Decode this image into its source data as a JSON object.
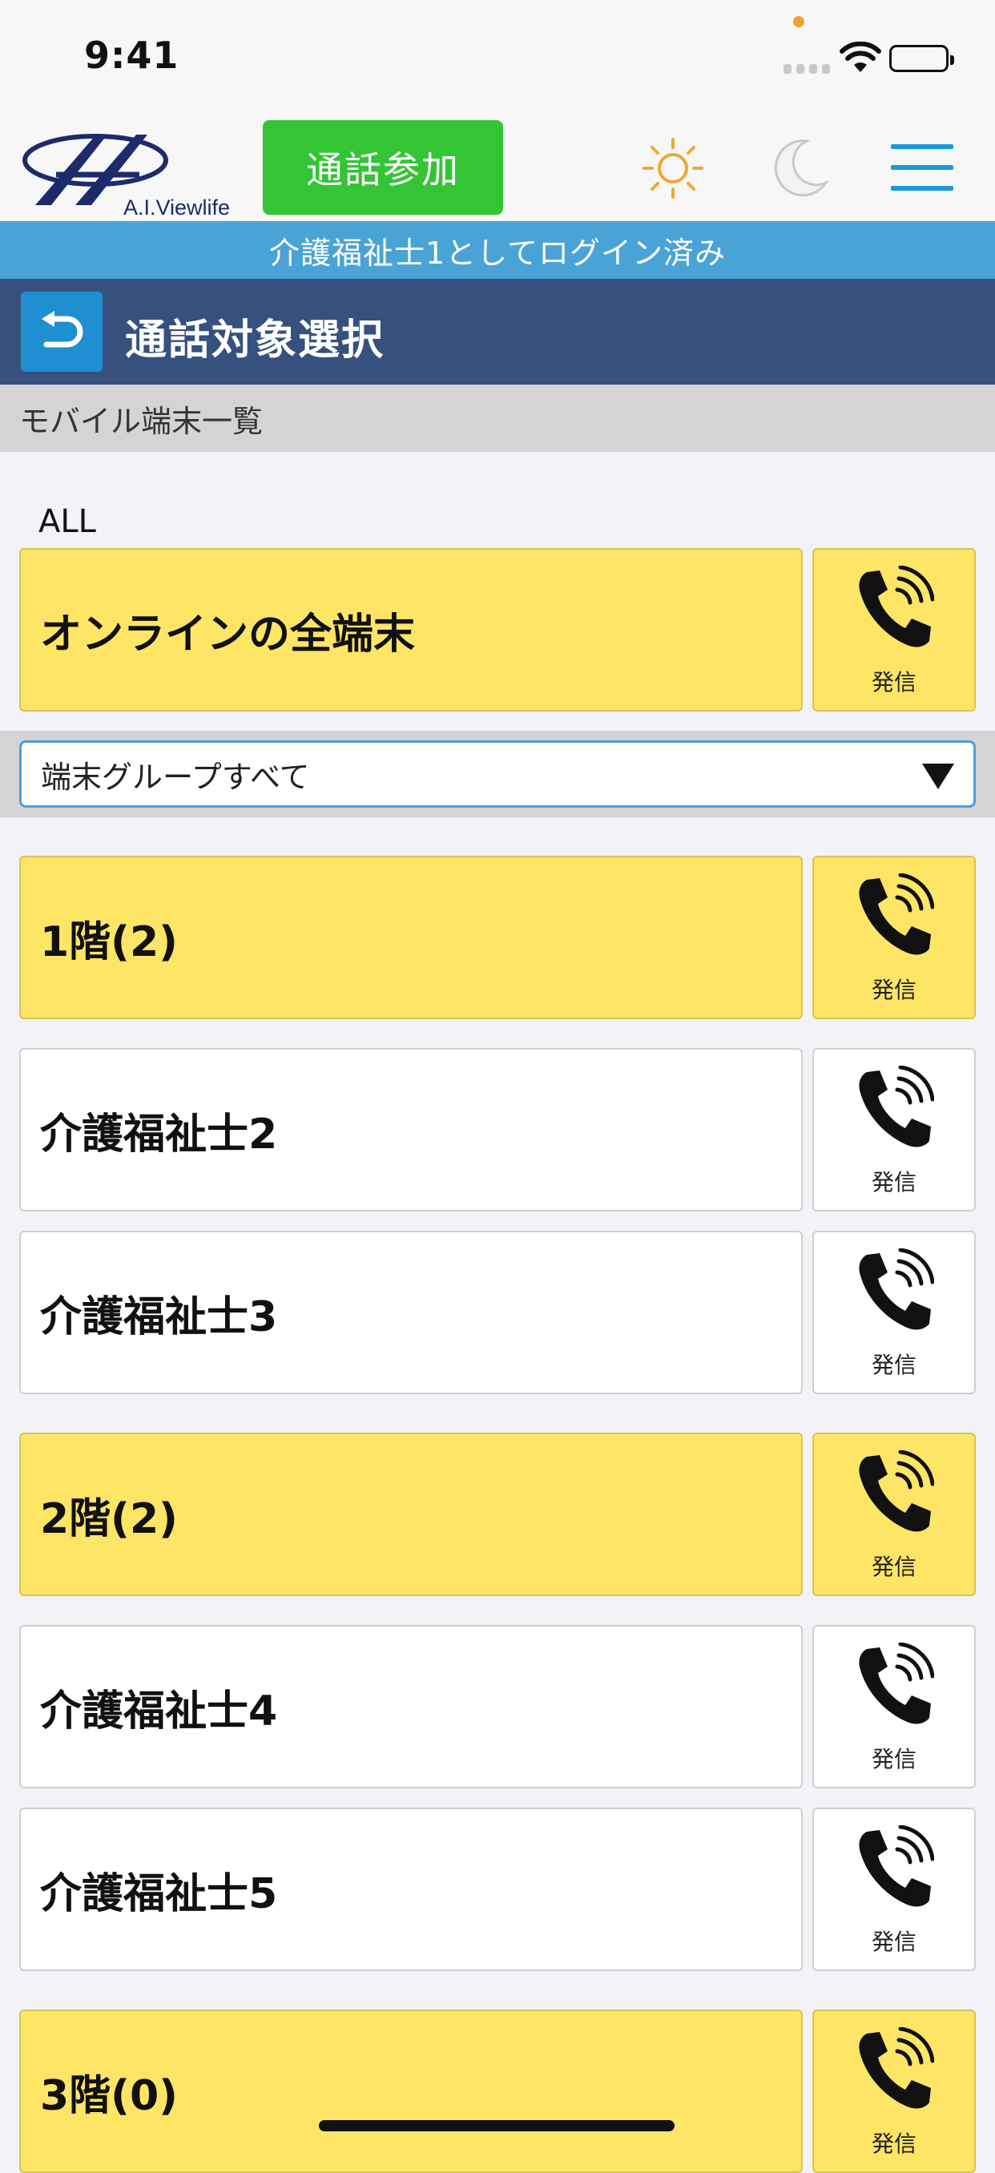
{
  "status_bar": {
    "time": "9:41"
  },
  "header": {
    "logo_text": "A.I.Viewlife",
    "join_call_label": "通話参加"
  },
  "login_banner": "介護福祉士1としてログイン済み",
  "title_bar": {
    "title": "通話対象選択"
  },
  "section": {
    "title": "モバイル端末一覧",
    "all_label": "ALL"
  },
  "all_row": {
    "name": "オンラインの全端末",
    "call_label": "発信"
  },
  "group_filter": {
    "selected": "端末グループすべて"
  },
  "rows": [
    {
      "name": "1階(2)",
      "call_label": "発信"
    },
    {
      "name": "介護福祉士2",
      "call_label": "発信"
    },
    {
      "name": "介護福祉士3",
      "call_label": "発信"
    },
    {
      "name": "2階(2)",
      "call_label": "発信"
    },
    {
      "name": "介護福祉士4",
      "call_label": "発信"
    },
    {
      "name": "介護福祉士5",
      "call_label": "発信"
    },
    {
      "name": "3階(0)",
      "call_label": "発信"
    }
  ],
  "colors": {
    "group_row": "#fee566",
    "join_button": "#33c533",
    "login_banner": "#4aa3d6",
    "title_bar": "#37517e",
    "back_button": "#1f8fd2"
  }
}
